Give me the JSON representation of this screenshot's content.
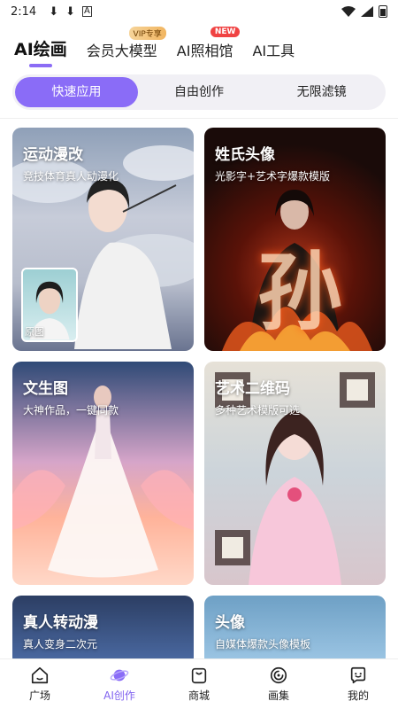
{
  "status_bar": {
    "time": "2:14",
    "notifications": [
      "download-icon",
      "download-icon",
      "app-icon"
    ]
  },
  "top_tabs": [
    {
      "label": "AI绘画",
      "active": true
    },
    {
      "label": "会员大模型",
      "badge": "VIP专享"
    },
    {
      "label": "AI照相馆",
      "badge": "NEW"
    },
    {
      "label": "AI工具"
    }
  ],
  "segments": [
    {
      "label": "快速应用",
      "active": true
    },
    {
      "label": "自由创作"
    },
    {
      "label": "无限滤镜"
    }
  ],
  "cards": [
    {
      "title": "运动漫改",
      "subtitle": "竞技体育真人动漫化",
      "thumb_label": "原图"
    },
    {
      "title": "姓氏头像",
      "subtitle": "光影字+艺术字爆款模版",
      "art_text": "孙"
    },
    {
      "title": "文生图",
      "subtitle": "大神作品，一键同款"
    },
    {
      "title": "艺术二维码",
      "subtitle": "多种艺术模版可选"
    },
    {
      "title": "真人转动漫",
      "subtitle": "真人变身二次元"
    },
    {
      "title": "头像",
      "subtitle": "自媒体爆款头像模板"
    }
  ],
  "bottom_nav": [
    {
      "label": "广场",
      "icon": "home-icon"
    },
    {
      "label": "AI创作",
      "icon": "planet-icon",
      "active": true
    },
    {
      "label": "商城",
      "icon": "shopping-bag-icon"
    },
    {
      "label": "画集",
      "icon": "gallery-icon"
    },
    {
      "label": "我的",
      "icon": "profile-chat-icon"
    }
  ],
  "colors": {
    "accent": "#8a6cf7",
    "vip_badge": "#f1b560",
    "new_badge": "#f04343"
  }
}
